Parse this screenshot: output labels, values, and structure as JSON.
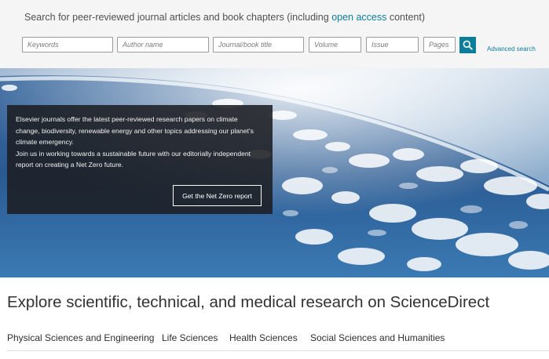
{
  "search": {
    "heading_prefix": "Search for peer-reviewed journal articles and book chapters (including ",
    "heading_link": "open access",
    "heading_suffix": " content)",
    "fields": {
      "keywords_placeholder": "Keywords",
      "author_placeholder": "Author name",
      "journal_placeholder": "Journal/book title",
      "volume_placeholder": "Volume",
      "issue_placeholder": "Issue",
      "pages_placeholder": "Pages"
    },
    "search_icon": "search-icon",
    "advanced_link": "Advanced search"
  },
  "hero": {
    "promo_line1": "Elsevier journals offer the latest peer-reviewed research papers on climate change, biodiversity, renewable energy and other topics addressing our planet's climate emergency.",
    "promo_line2": "Join us in working towards a sustainable future with our editorially independent report on creating a Net Zero future.",
    "cta_label": "Get the Net Zero report"
  },
  "explore": {
    "title": "Explore scientific, technical, and medical research on ScienceDirect",
    "categories": [
      "Physical Sciences and Engineering",
      "Life Sciences",
      "Health Sciences",
      "Social Sciences and Humanities"
    ]
  },
  "colors": {
    "accent": "#0c7d9b",
    "promo_background": "#1c1e22",
    "search_band": "#f5f5f5"
  }
}
